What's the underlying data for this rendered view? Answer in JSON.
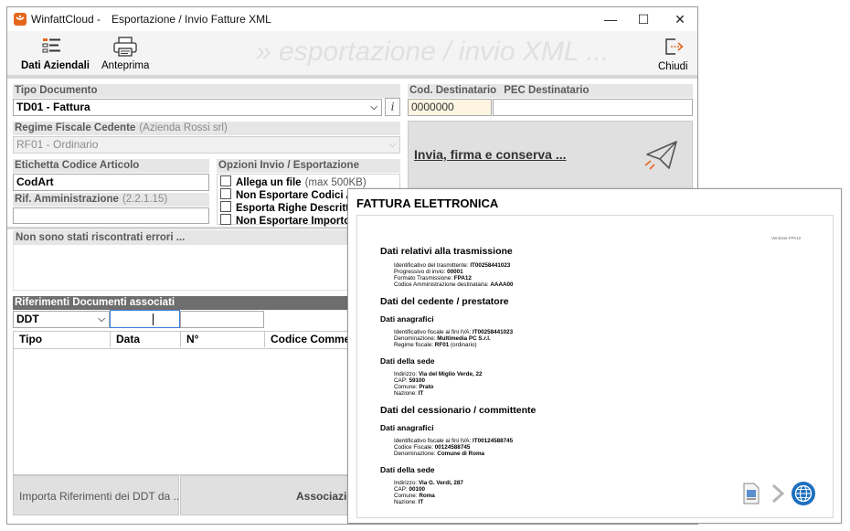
{
  "window": {
    "app_name": "WinfattCloud",
    "dash": "-",
    "title": "Esportazione / Invio Fatture XML",
    "controls": {
      "minimize": "—",
      "maximize": "☐",
      "close": "✕"
    }
  },
  "toolbar": {
    "dati_aziendali": "Dati Aziendali",
    "anteprima": "Anteprima",
    "chiudi": "Chiudi",
    "watermark": "» esportazione / invio XML ..."
  },
  "tipo_documento": {
    "label": "Tipo Documento",
    "value": "TD01 - Fattura"
  },
  "regime_fiscale": {
    "label": "Regime Fiscale Cedente",
    "sub": "(Azienda Rossi srl)",
    "value": "RF01 - Ordinario"
  },
  "etichetta": {
    "label": "Etichetta Codice Articolo",
    "value": "CodArt"
  },
  "rif_amministrazione": {
    "label": "Rif. Amministrazione",
    "sub": "(2.2.1.15)",
    "value": ""
  },
  "opzioni": {
    "label": "Opzioni Invio / Esportazione",
    "items": [
      {
        "label": "Allega un file",
        "sub": "(max 500KB)"
      },
      {
        "label": "Non Esportare Codici Articolo",
        "sub": ""
      },
      {
        "label": "Esporta Righe Descrittive",
        "sub": ""
      },
      {
        "label": "Non Esportare Importo Bollo",
        "sub": ""
      }
    ]
  },
  "destinatario": {
    "cod_label": "Cod. Destinatario",
    "pec_label": "PEC Destinatario",
    "cod_value": "0000000",
    "pec_value": ""
  },
  "send": {
    "label": "Invia, firma e conserva ..."
  },
  "errors": {
    "message": "Non sono stati riscontrati errori ..."
  },
  "riferimenti": {
    "label": "Riferimenti Documenti associati",
    "type_value": "DDT",
    "columns": [
      "Tipo",
      "Data",
      "N°",
      "Codice Commessa"
    ]
  },
  "bottom": {
    "importa": "Importa Riferimenti dei DDT da ...",
    "associa": "Associazione"
  },
  "preview": {
    "title": "FATTURA ELETTRONICA",
    "version": "Versione FPA12",
    "sections": {
      "trasmissione": "Dati relativi alla trasmissione",
      "cedente": "Dati del cedente / prestatore",
      "cessionario": "Dati del cessionario / committente",
      "anagrafici": "Dati anagrafici",
      "sede": "Dati della sede"
    },
    "trasmissione": [
      {
        "k": "Identificativo del trasmittente:",
        "v": "IT00258441023"
      },
      {
        "k": "Progressivo di invio:",
        "v": "00001"
      },
      {
        "k": "Formato Trasmissione:",
        "v": "FPA12"
      },
      {
        "k": "Codice Amministrazione destinataria:",
        "v": "AAAA00"
      }
    ],
    "cedente_anagrafici": [
      {
        "k": "Identificativo fiscale ai fini IVA:",
        "v": "IT00258441023"
      },
      {
        "k": "Denominazione:",
        "v": "Multimedia PC S.r.l."
      },
      {
        "k": "Regime fiscale:",
        "v": "RF01",
        "extra": "(ordinario)"
      }
    ],
    "cedente_sede": [
      {
        "k": "Indirizzo:",
        "v": "Via del Miglio Verde, 22"
      },
      {
        "k": "CAP:",
        "v": "59100"
      },
      {
        "k": "Comune:",
        "v": "Prato"
      },
      {
        "k": "Nazione:",
        "v": "IT"
      }
    ],
    "cessionario_anagrafici": [
      {
        "k": "Identificativo fiscale ai fini IVA:",
        "v": "IT00124588745"
      },
      {
        "k": "Codice Fiscale:",
        "v": "00124588745"
      },
      {
        "k": "Denominazione:",
        "v": "Comune di Roma"
      }
    ],
    "cessionario_sede": [
      {
        "k": "Indirizzo:",
        "v": "Via G. Verdi, 287"
      },
      {
        "k": "CAP:",
        "v": "00100"
      },
      {
        "k": "Comune:",
        "v": "Roma"
      },
      {
        "k": "Nazione:",
        "v": "IT"
      }
    ]
  },
  "colors": {
    "app_orange": "#e5671e",
    "send_icon": "#555555",
    "globe_blue": "#1e6fbf"
  }
}
